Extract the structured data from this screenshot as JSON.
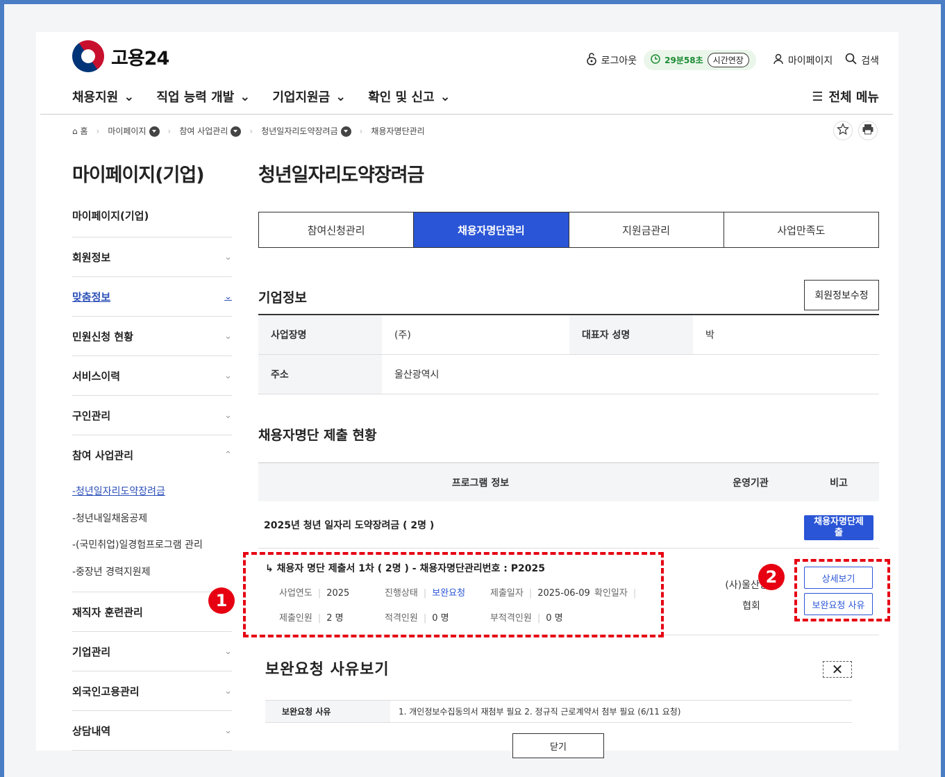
{
  "header": {
    "logo_text": "고용24",
    "logout": "로그아웃",
    "timer": "29분58초",
    "extend": "시간연장",
    "mypage": "마이페이지",
    "search": "검색",
    "nav": [
      "채용지원",
      "직업 능력 개발",
      "기업지원금",
      "확인 및 신고"
    ],
    "all_menu": "전체 메뉴"
  },
  "breadcrumb": [
    "홈",
    "마이페이지",
    "참여 사업관리",
    "청년일자리도약장려금",
    "채용자명단관리"
  ],
  "sidebar": {
    "title": "마이페이지(기업)",
    "items": [
      {
        "label": "마이페이지(기업)"
      },
      {
        "label": "회원정보"
      },
      {
        "label": "맞춤정보"
      },
      {
        "label": "민원신청 현황"
      },
      {
        "label": "서비스이력"
      },
      {
        "label": "구인관리"
      },
      {
        "label": "참여 사업관리"
      },
      {
        "label": "재직자 훈련관리"
      },
      {
        "label": "기업관리"
      },
      {
        "label": "외국인고용관리"
      },
      {
        "label": "상담내역"
      }
    ],
    "sub_items": [
      "-청년일자리도약장려금",
      "-청년내일채움공제",
      "-(국민취업)일경험프로그램 관리",
      "-중장년 경력지원제"
    ]
  },
  "main": {
    "title": "청년일자리도약장려금",
    "tabs": [
      "참여신청관리",
      "채용자명단관리",
      "지원금관리",
      "사업만족도"
    ],
    "company_section": "기업정보",
    "edit_member_btn": "회원정보수정",
    "company": {
      "name_label": "사업장명",
      "name_value": "(주)",
      "ceo_label": "대표자 성명",
      "ceo_value": "박",
      "address_label": "주소",
      "address_value": "울산광역시"
    },
    "status_section": "채용자명단 제출 현황",
    "columns": [
      "프로그램 정보",
      "운영기관",
      "비고"
    ],
    "program_name": "2025년 청년 일자리 도약장려금 ( 2명 )",
    "submit_btn": "채용자명단제출",
    "detail": {
      "title": "↳ 채용자 명단 제출서 1차 ( 2명 ) - 채용자명단관리번호 : P2025",
      "year_label": "사업연도",
      "year_value": "2025",
      "status_label": "진행상태",
      "status_value": "보완요청",
      "submit_date_label": "제출일자",
      "submit_date_value": "2025-06-09",
      "confirm_date_label": "확인일자",
      "count_label": "제출인원",
      "count_value": "2 명",
      "eligible_label": "적격인원",
      "eligible_value": "0 명",
      "ineligible_label": "부적격인원",
      "ineligible_value": "0 명",
      "org_line1": "(사)울산양산",
      "org_line2": "협회",
      "view_btn": "상세보기",
      "reason_btn": "보완요청 사유"
    },
    "badge1": "1",
    "badge2": "2"
  },
  "modal": {
    "title": "보완요청 사유보기",
    "reason_label": "보완요청 사유",
    "reason_value": "1. 개인정보수집동의서 재첨부 필요 2. 정규직 근로계약서 첨부 필요 (6/11 요청)",
    "close_btn": "닫기"
  },
  "colors": {
    "accent": "#2a55d6",
    "callout": "#e60012",
    "timer": "#1b8a32"
  }
}
